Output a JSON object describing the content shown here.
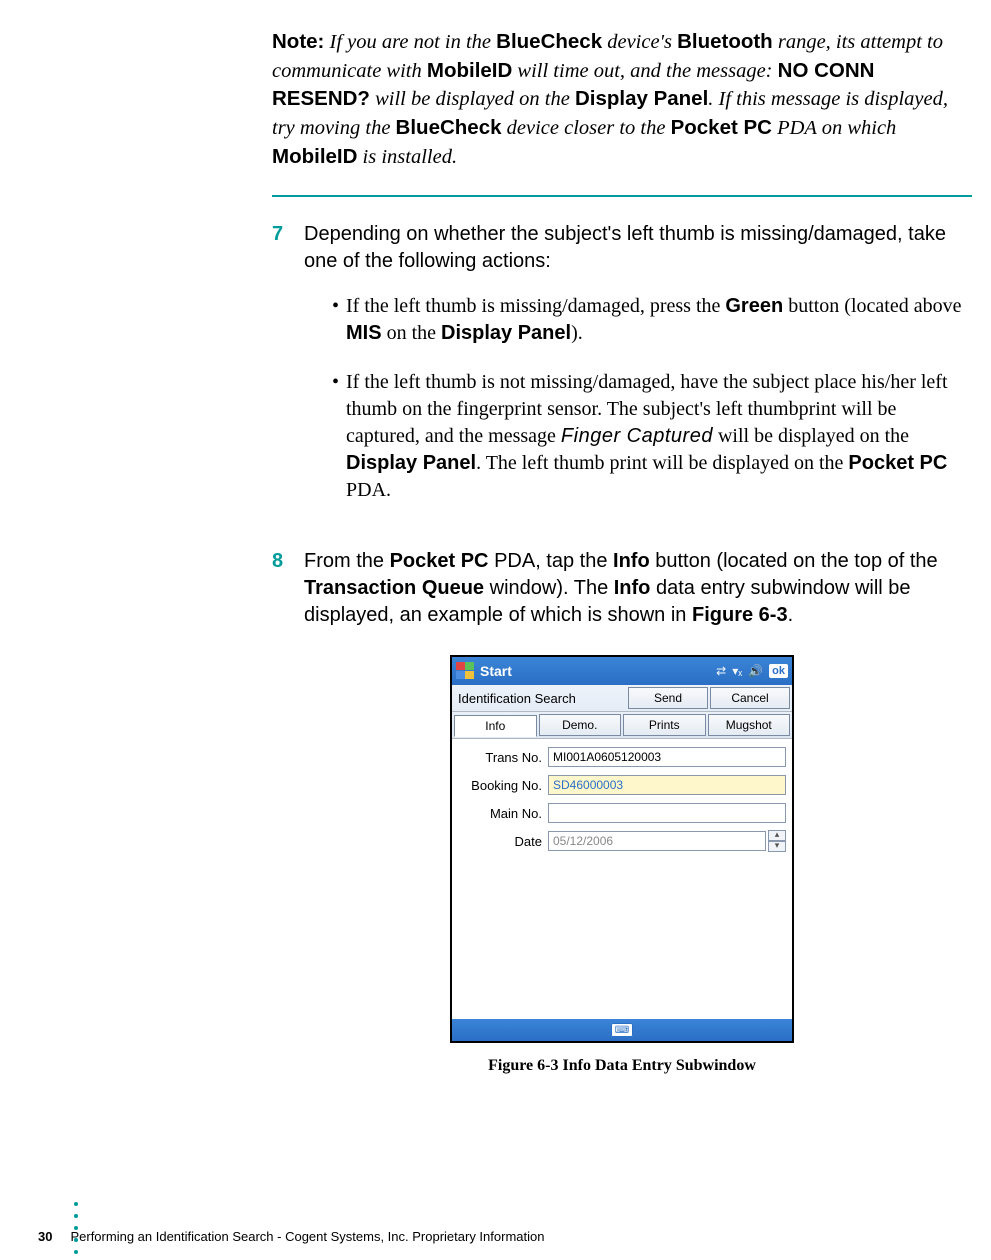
{
  "note": {
    "label": "Note:",
    "text_1": " If you are not in the ",
    "bluecheck": "BlueCheck",
    "text_2": " device's ",
    "bluetooth": "Bluetooth",
    "text_3": " range, its attempt to communicate with ",
    "mobileid": "MobileID",
    "text_4": " will time out, and the message: ",
    "noconn": "NO CONN RESEND?",
    "text_5": " will be displayed on the ",
    "display_panel": "Display Panel",
    "text_6": ". If this message is displayed, try moving the ",
    "text_7": " device closer to the ",
    "pocketpc": "Pocket PC",
    "text_8": " PDA on which ",
    "text_9": " is installed."
  },
  "step7": {
    "num": "7",
    "text": "Depending on whether the subject's left thumb is missing/damaged, take one of the following actions:"
  },
  "step7_bullet1": {
    "p1": "If the left thumb is missing/damaged, press the ",
    "green": "Green",
    "p2": " button (located above ",
    "mis": "MIS",
    "p3": " on the ",
    "dp": "Display Panel",
    "p4": ")."
  },
  "step7_bullet2": {
    "p1": "If the left thumb is not missing/damaged, have the subject place his/her left thumb on the fingerprint sensor. The subject's left thumbprint will be captured, and the message ",
    "fc": "Finger Captured",
    "p2": " will be displayed on the ",
    "dp": "Display Panel",
    "p3": ". The left thumb print will be displayed on the ",
    "ppc": "Pocket PC",
    "p4": " PDA."
  },
  "step8": {
    "num": "8",
    "p1": "From the ",
    "ppc": "Pocket PC",
    "p2": " PDA, tap the ",
    "info": "Info",
    "p3": " button (located on the top of the ",
    "tq": "Transaction Queue",
    "p4": " window). The ",
    "p5": " data entry subwindow will be displayed, an example of which is shown in ",
    "fig": "Figure 6-3",
    "p6": "."
  },
  "device": {
    "start": "Start",
    "ok": "ok",
    "id_search": "Identification Search",
    "send": "Send",
    "cancel": "Cancel",
    "tabs": {
      "info": "Info",
      "demo": "Demo.",
      "prints": "Prints",
      "mugshot": "Mugshot"
    },
    "labels": {
      "trans": "Trans No.",
      "booking": "Booking No.",
      "main": "Main No.",
      "date": "Date"
    },
    "values": {
      "trans": "MI001A0605120003",
      "booking": "SD46000003",
      "main": "",
      "date": "05/12/2006"
    }
  },
  "figure_caption": "Figure 6-3 Info Data Entry Subwindow",
  "footer": {
    "page": "30",
    "text": "Performing an Identification Search  - Cogent Systems, Inc. Proprietary Information"
  }
}
